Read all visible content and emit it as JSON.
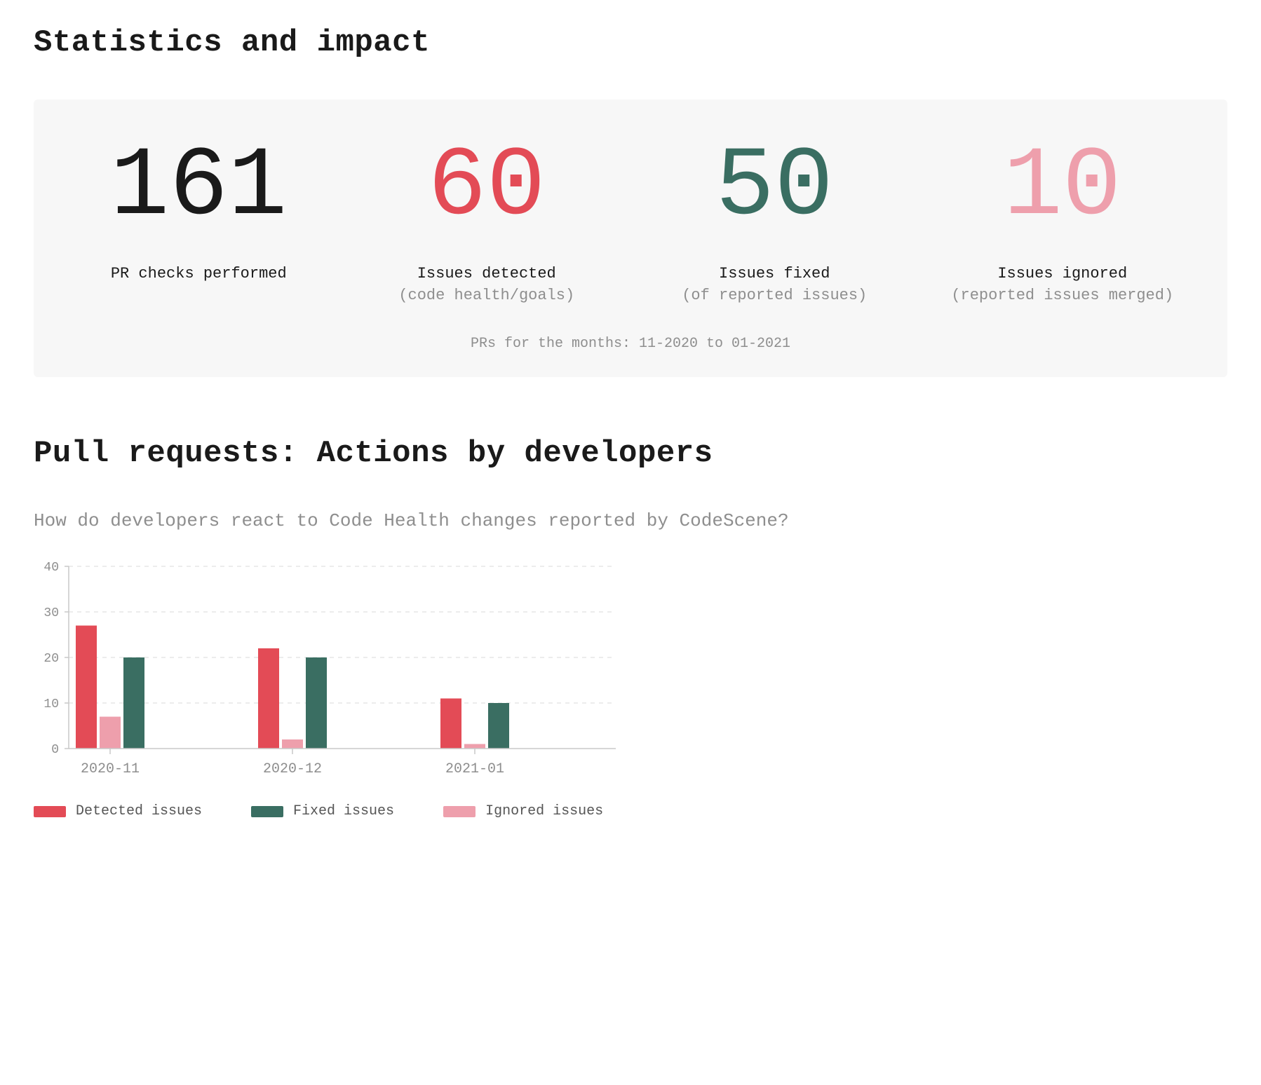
{
  "colors": {
    "black": "#1a1a1a",
    "red": "#e34b56",
    "green": "#3a6e62",
    "pink": "#ee9fac"
  },
  "section1": {
    "title": "Statistics and impact",
    "stats": [
      {
        "value": "161",
        "color": "black",
        "label": "PR checks performed",
        "sublabel": ""
      },
      {
        "value": "60",
        "color": "red",
        "label": "Issues detected",
        "sublabel": "(code health/goals)"
      },
      {
        "value": "50",
        "color": "green",
        "label": "Issues fixed",
        "sublabel": "(of reported issues)"
      },
      {
        "value": "10",
        "color": "pink",
        "label": "Issues ignored",
        "sublabel": "(reported issues merged)"
      }
    ],
    "footer": "PRs for the months: 11-2020 to 01-2021"
  },
  "section2": {
    "title": "Pull requests: Actions by developers",
    "subtitle": "How do developers react to Code Health changes reported by CodeScene?"
  },
  "chart_data": {
    "type": "bar",
    "categories": [
      "2020-11",
      "2020-12",
      "2021-01"
    ],
    "series": [
      {
        "name": "Detected issues",
        "color": "red",
        "values": [
          27,
          22,
          11
        ]
      },
      {
        "name": "Ignored issues",
        "color": "pink",
        "values": [
          7,
          2,
          1
        ]
      },
      {
        "name": "Fixed issues",
        "color": "green",
        "values": [
          20,
          20,
          10
        ]
      }
    ],
    "legend_order": [
      "Detected issues",
      "Fixed issues",
      "Ignored issues"
    ],
    "ylim": [
      0,
      40
    ],
    "yticks": [
      0,
      10,
      20,
      30,
      40
    ],
    "xlabel": "",
    "ylabel": "",
    "grid": true
  }
}
